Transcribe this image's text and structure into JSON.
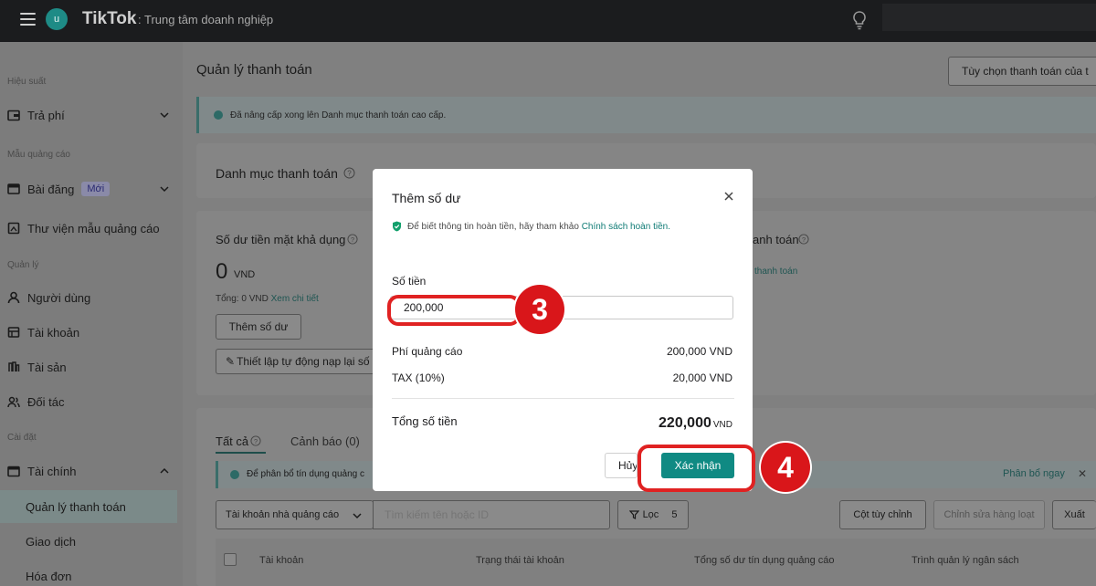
{
  "topbar": {
    "avatar_initial": "u",
    "logo": "TikTok",
    "subtitle": ": Trung tâm doanh nghiệp"
  },
  "sidebar": {
    "section_performance": "Hiệu suất",
    "item_payment": "Trả phí",
    "section_ad_templates": "Mẫu quảng cáo",
    "item_posts": "Bài đăng",
    "item_posts_badge": "Mới",
    "item_ad_library": "Thư viện mẫu quảng cáo",
    "section_manage": "Quản lý",
    "item_users": "Người dùng",
    "item_accounts": "Tài khoản",
    "item_assets": "Tài sản",
    "item_partners": "Đối tác",
    "section_settings": "Cài đặt",
    "item_finance": "Tài chính",
    "sub_payment_management": "Quản lý thanh toán",
    "sub_transactions": "Giao dịch",
    "sub_invoices": "Hóa đơn"
  },
  "main": {
    "title": "Quản lý thanh toán",
    "payment_options_button": "Tùy chọn thanh toán của t",
    "info_banner": "Đã nâng cấp xong lên Danh mục thanh toán cao cấp.",
    "portfolio_title": "Danh mục thanh toán",
    "balance_label": "Số dư tiền mặt khả dụng",
    "balance_amount": "0",
    "balance_currency": "VND",
    "total_text": "Tổng: 0 VND",
    "details_link": "Xem chi tiết",
    "add_balance_button": "Thêm số dư",
    "auto_topup_button": "Thiết lập tự động nạp lại số",
    "right_label_fragment": "anh toán",
    "right_link_fragment": "thanh toán",
    "tab_all": "Tất cả",
    "tab_alerts": "Cảnh báo (0)",
    "alert_banner": "Để phân bổ tín dụng quảng c",
    "allocate_now": "Phân bổ ngay",
    "filter_select": "Tài khoản nhà quảng cáo",
    "search_placeholder": "Tìm kiếm tên hoặc ID",
    "filter_button": "Lọc",
    "filter_count": "5",
    "custom_columns_button": "Cột tùy chỉnh",
    "bulk_edit_button": "Chỉnh sửa hàng loạt",
    "export_button": "Xuất",
    "columns": [
      "Tài khoản",
      "Trạng thái tài khoản",
      "Tổng số dư tín dụng quảng cáo",
      "Trình quản lý ngân sách"
    ]
  },
  "modal": {
    "title": "Thêm số dư",
    "note_text": "Để biết thông tin hoàn tiền, hãy tham khảo",
    "note_link": "Chính sách hoàn tiền.",
    "amount_label": "Số tiền",
    "amount_value": "200,000",
    "ad_fee_label": "Phí quảng cáo",
    "ad_fee_value": "200,000 VND",
    "tax_label": "TAX (10%)",
    "tax_value": "20,000 VND",
    "total_label": "Tổng số tiền",
    "total_value": "220,000",
    "total_currency": "VND",
    "cancel_button": "Hủy",
    "confirm_button": "Xác nhận"
  },
  "annotations": {
    "step_3": "3",
    "step_4": "4",
    "highlight_color": "#e02222"
  },
  "colors": {
    "accent": "#0f8a83",
    "topbar": "#1b1c1e",
    "step_badge": "#d9161a"
  }
}
